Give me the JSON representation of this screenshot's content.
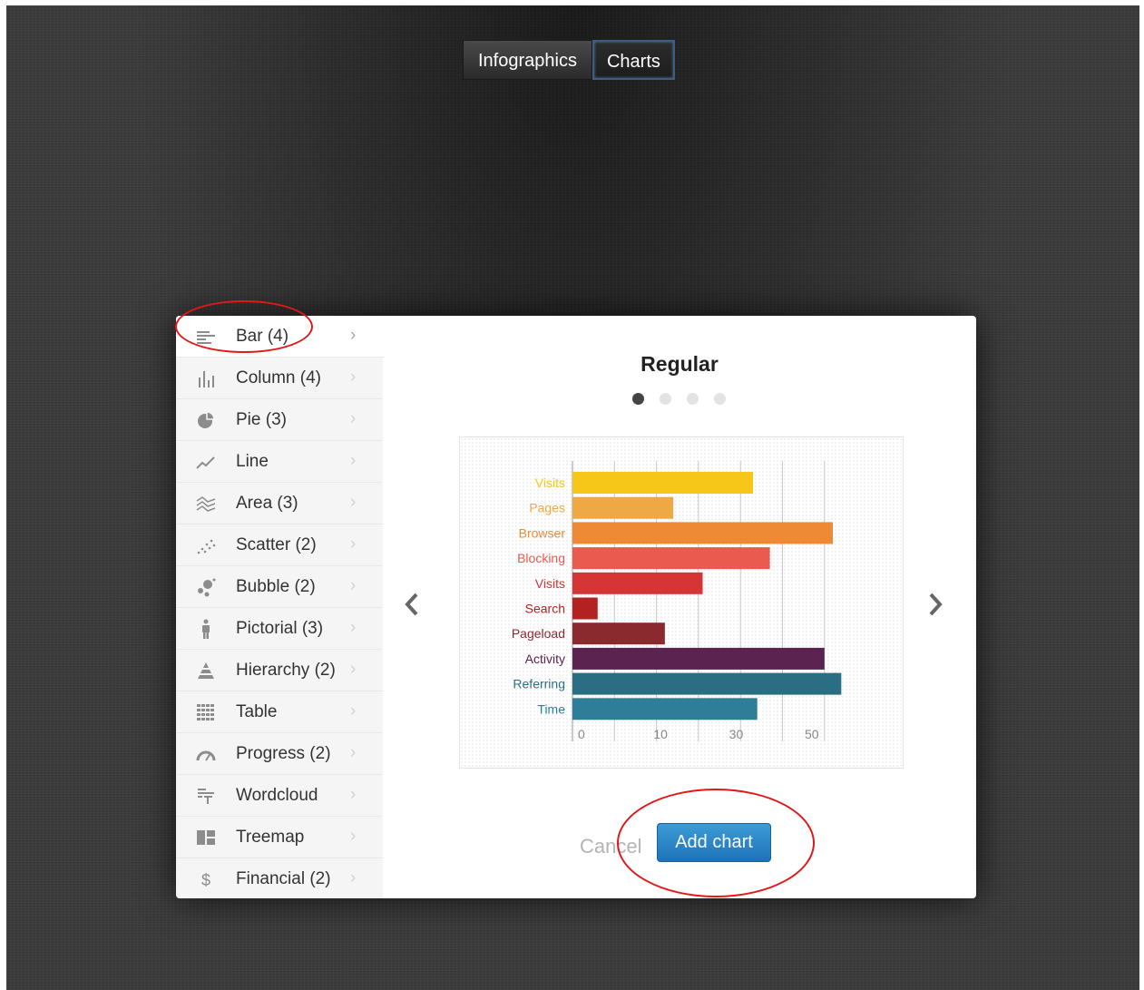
{
  "topnav": {
    "infographics": "Infographics",
    "charts": "Charts"
  },
  "sidebar": {
    "items": [
      {
        "label": "Bar (4)",
        "icon": "bar-chart-icon",
        "active": true
      },
      {
        "label": "Column (4)",
        "icon": "column-chart-icon"
      },
      {
        "label": "Pie (3)",
        "icon": "pie-chart-icon"
      },
      {
        "label": "Line",
        "icon": "line-chart-icon"
      },
      {
        "label": "Area (3)",
        "icon": "area-chart-icon"
      },
      {
        "label": "Scatter (2)",
        "icon": "scatter-chart-icon"
      },
      {
        "label": "Bubble (2)",
        "icon": "bubble-chart-icon"
      },
      {
        "label": "Pictorial (3)",
        "icon": "person-icon"
      },
      {
        "label": "Hierarchy (2)",
        "icon": "pyramid-icon"
      },
      {
        "label": "Table",
        "icon": "table-icon"
      },
      {
        "label": "Progress (2)",
        "icon": "gauge-icon"
      },
      {
        "label": "Wordcloud",
        "icon": "wordcloud-icon"
      },
      {
        "label": "Treemap",
        "icon": "treemap-icon"
      },
      {
        "label": "Financial (2)",
        "icon": "dollar-icon"
      }
    ],
    "chevron": "›"
  },
  "preview": {
    "title": "Regular",
    "dots": 4,
    "active_dot": 0,
    "cancel_label": "Cancel",
    "add_label": "Add chart"
  },
  "chart_data": {
    "type": "bar",
    "orientation": "horizontal",
    "categories": [
      "Visits",
      "Pages",
      "Browser",
      "Blocking",
      "Visits",
      "Search",
      "Pageload",
      "Activity",
      "Referring",
      "Time"
    ],
    "values": [
      43,
      24,
      62,
      47,
      31,
      6,
      22,
      60,
      64,
      44
    ],
    "colors": [
      "#f6c719",
      "#efa944",
      "#ee8a35",
      "#ea5a4f",
      "#d63535",
      "#b32121",
      "#8b2a2e",
      "#5b2350",
      "#2b6e84",
      "#2e7e99"
    ],
    "x_ticks": [
      "0",
      "10",
      "30",
      "50"
    ],
    "xlim": [
      0,
      70
    ],
    "grid": true
  },
  "accent_color": "#2681c8",
  "annotation_color": "#e21818"
}
